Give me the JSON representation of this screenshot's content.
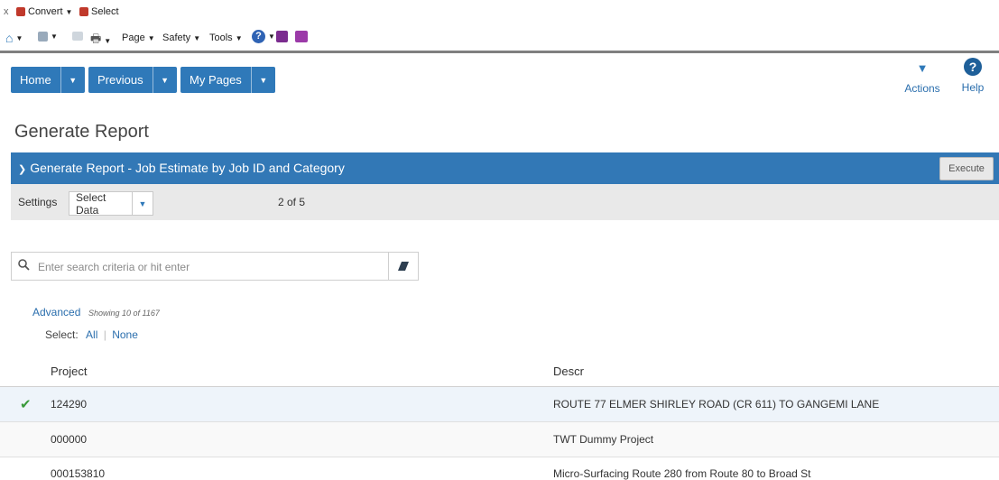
{
  "browser": {
    "convert_label": "Convert",
    "select_label": "Select",
    "page_label": "Page",
    "safety_label": "Safety",
    "tools_label": "Tools"
  },
  "nav": {
    "home": "Home",
    "previous": "Previous",
    "my_pages": "My Pages",
    "actions": "Actions",
    "help": "Help"
  },
  "page": {
    "title": "Generate Report",
    "panel_title": "Generate Report - Job Estimate by Job ID and Category",
    "execute": "Execute"
  },
  "settings": {
    "label": "Settings",
    "select_value": "Select Data",
    "step": "2 of 5"
  },
  "search": {
    "placeholder": "Enter search criteria or hit enter"
  },
  "list": {
    "advanced": "Advanced",
    "showing": "Showing 10 of 1167",
    "select_label": "Select:",
    "all": "All",
    "none": "None",
    "columns": [
      "Project",
      "Descr"
    ],
    "rows": [
      {
        "project": "124290",
        "descr": "ROUTE 77 ELMER SHIRLEY ROAD (CR 611) TO GANGEMI LANE",
        "selected": true
      },
      {
        "project": "000000",
        "descr": "TWT Dummy Project",
        "selected": false
      },
      {
        "project": "000153810",
        "descr": "Micro-Surfacing Route 280 from Route 80 to Broad St",
        "selected": false
      }
    ]
  },
  "colors": {
    "primary": "#2f79b9",
    "panel": "#3278b6",
    "selected_row": "#eef4fa",
    "check": "#3a9a3a"
  }
}
